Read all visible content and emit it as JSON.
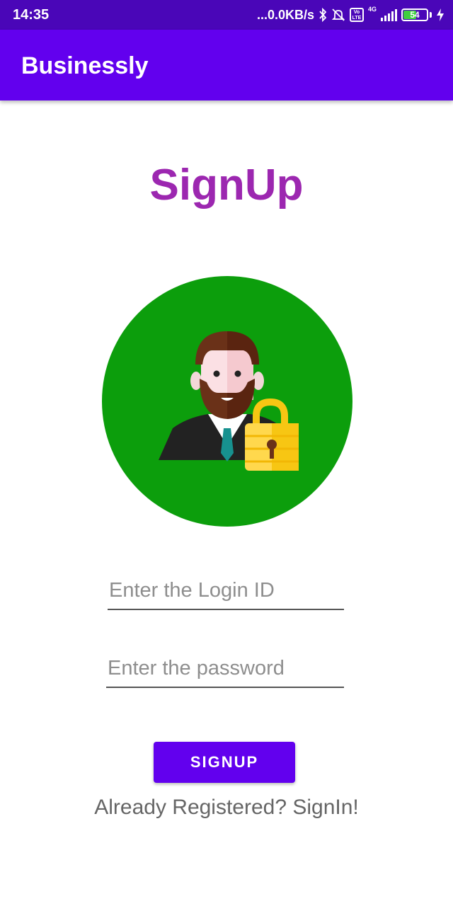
{
  "status_bar": {
    "time": "14:35",
    "network_speed": "...0.0KB/s",
    "network_type": "4G",
    "volte_label": "Vo LTE",
    "battery_level": "54",
    "icons": [
      "bluetooth-icon",
      "mute-icon",
      "volte-icon",
      "signal-icon",
      "battery-icon",
      "charging-icon"
    ]
  },
  "app_bar": {
    "title": "Businessly"
  },
  "main": {
    "page_title": "SignUp",
    "avatar_icon": "businessman-lock-icon",
    "login_field": {
      "placeholder": "Enter the Login ID",
      "value": ""
    },
    "password_field": {
      "placeholder": "Enter the password",
      "value": ""
    },
    "signup_button_label": "SIGNUP",
    "signin_link_text": "Already Registered? SignIn!"
  },
  "colors": {
    "status_bar": "#4a06b8",
    "app_bar": "#6200ee",
    "title": "#9c27b0",
    "avatar_background": "#0c9e0c",
    "button": "#6200ee"
  }
}
